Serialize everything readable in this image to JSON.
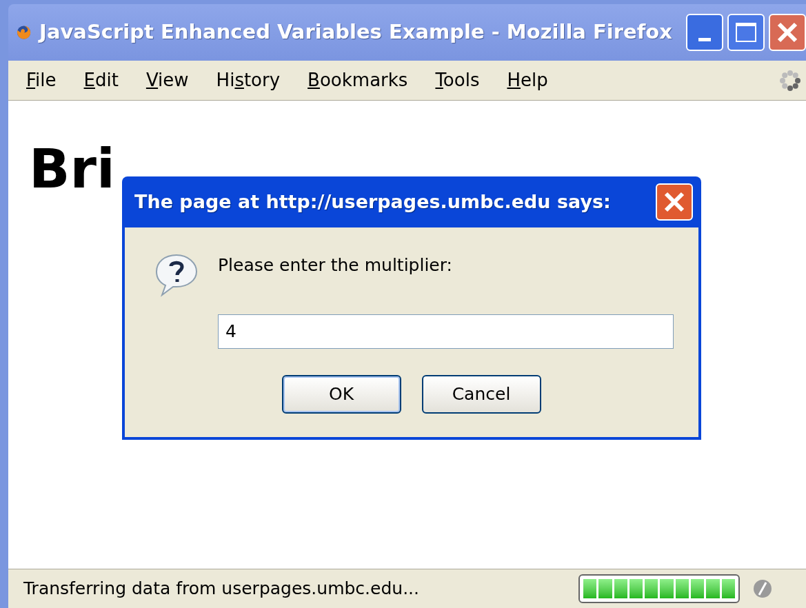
{
  "window": {
    "title": "JavaScript Enhanced Variables Example - Mozilla Firefox"
  },
  "menu": [
    {
      "access_key": "F",
      "after": "ile"
    },
    {
      "access_key": "E",
      "after": "dit"
    },
    {
      "access_key": "V",
      "after": "iew"
    },
    {
      "before": "Hi",
      "access_key": "s",
      "after": "tory"
    },
    {
      "access_key": "B",
      "after": "ookmarks"
    },
    {
      "access_key": "T",
      "after": "ools"
    },
    {
      "access_key": "H",
      "after": "elp"
    }
  ],
  "page": {
    "heading": "Bri"
  },
  "dialog": {
    "title": "The page at http://userpages.umbc.edu says:",
    "message": "Please enter the multiplier:",
    "value": "4",
    "buttons": [
      "OK",
      "Cancel"
    ]
  },
  "status_bar": {
    "text": "Transferring data from userpages.umbc.edu...",
    "progress": {
      "level": 1
    }
  }
}
